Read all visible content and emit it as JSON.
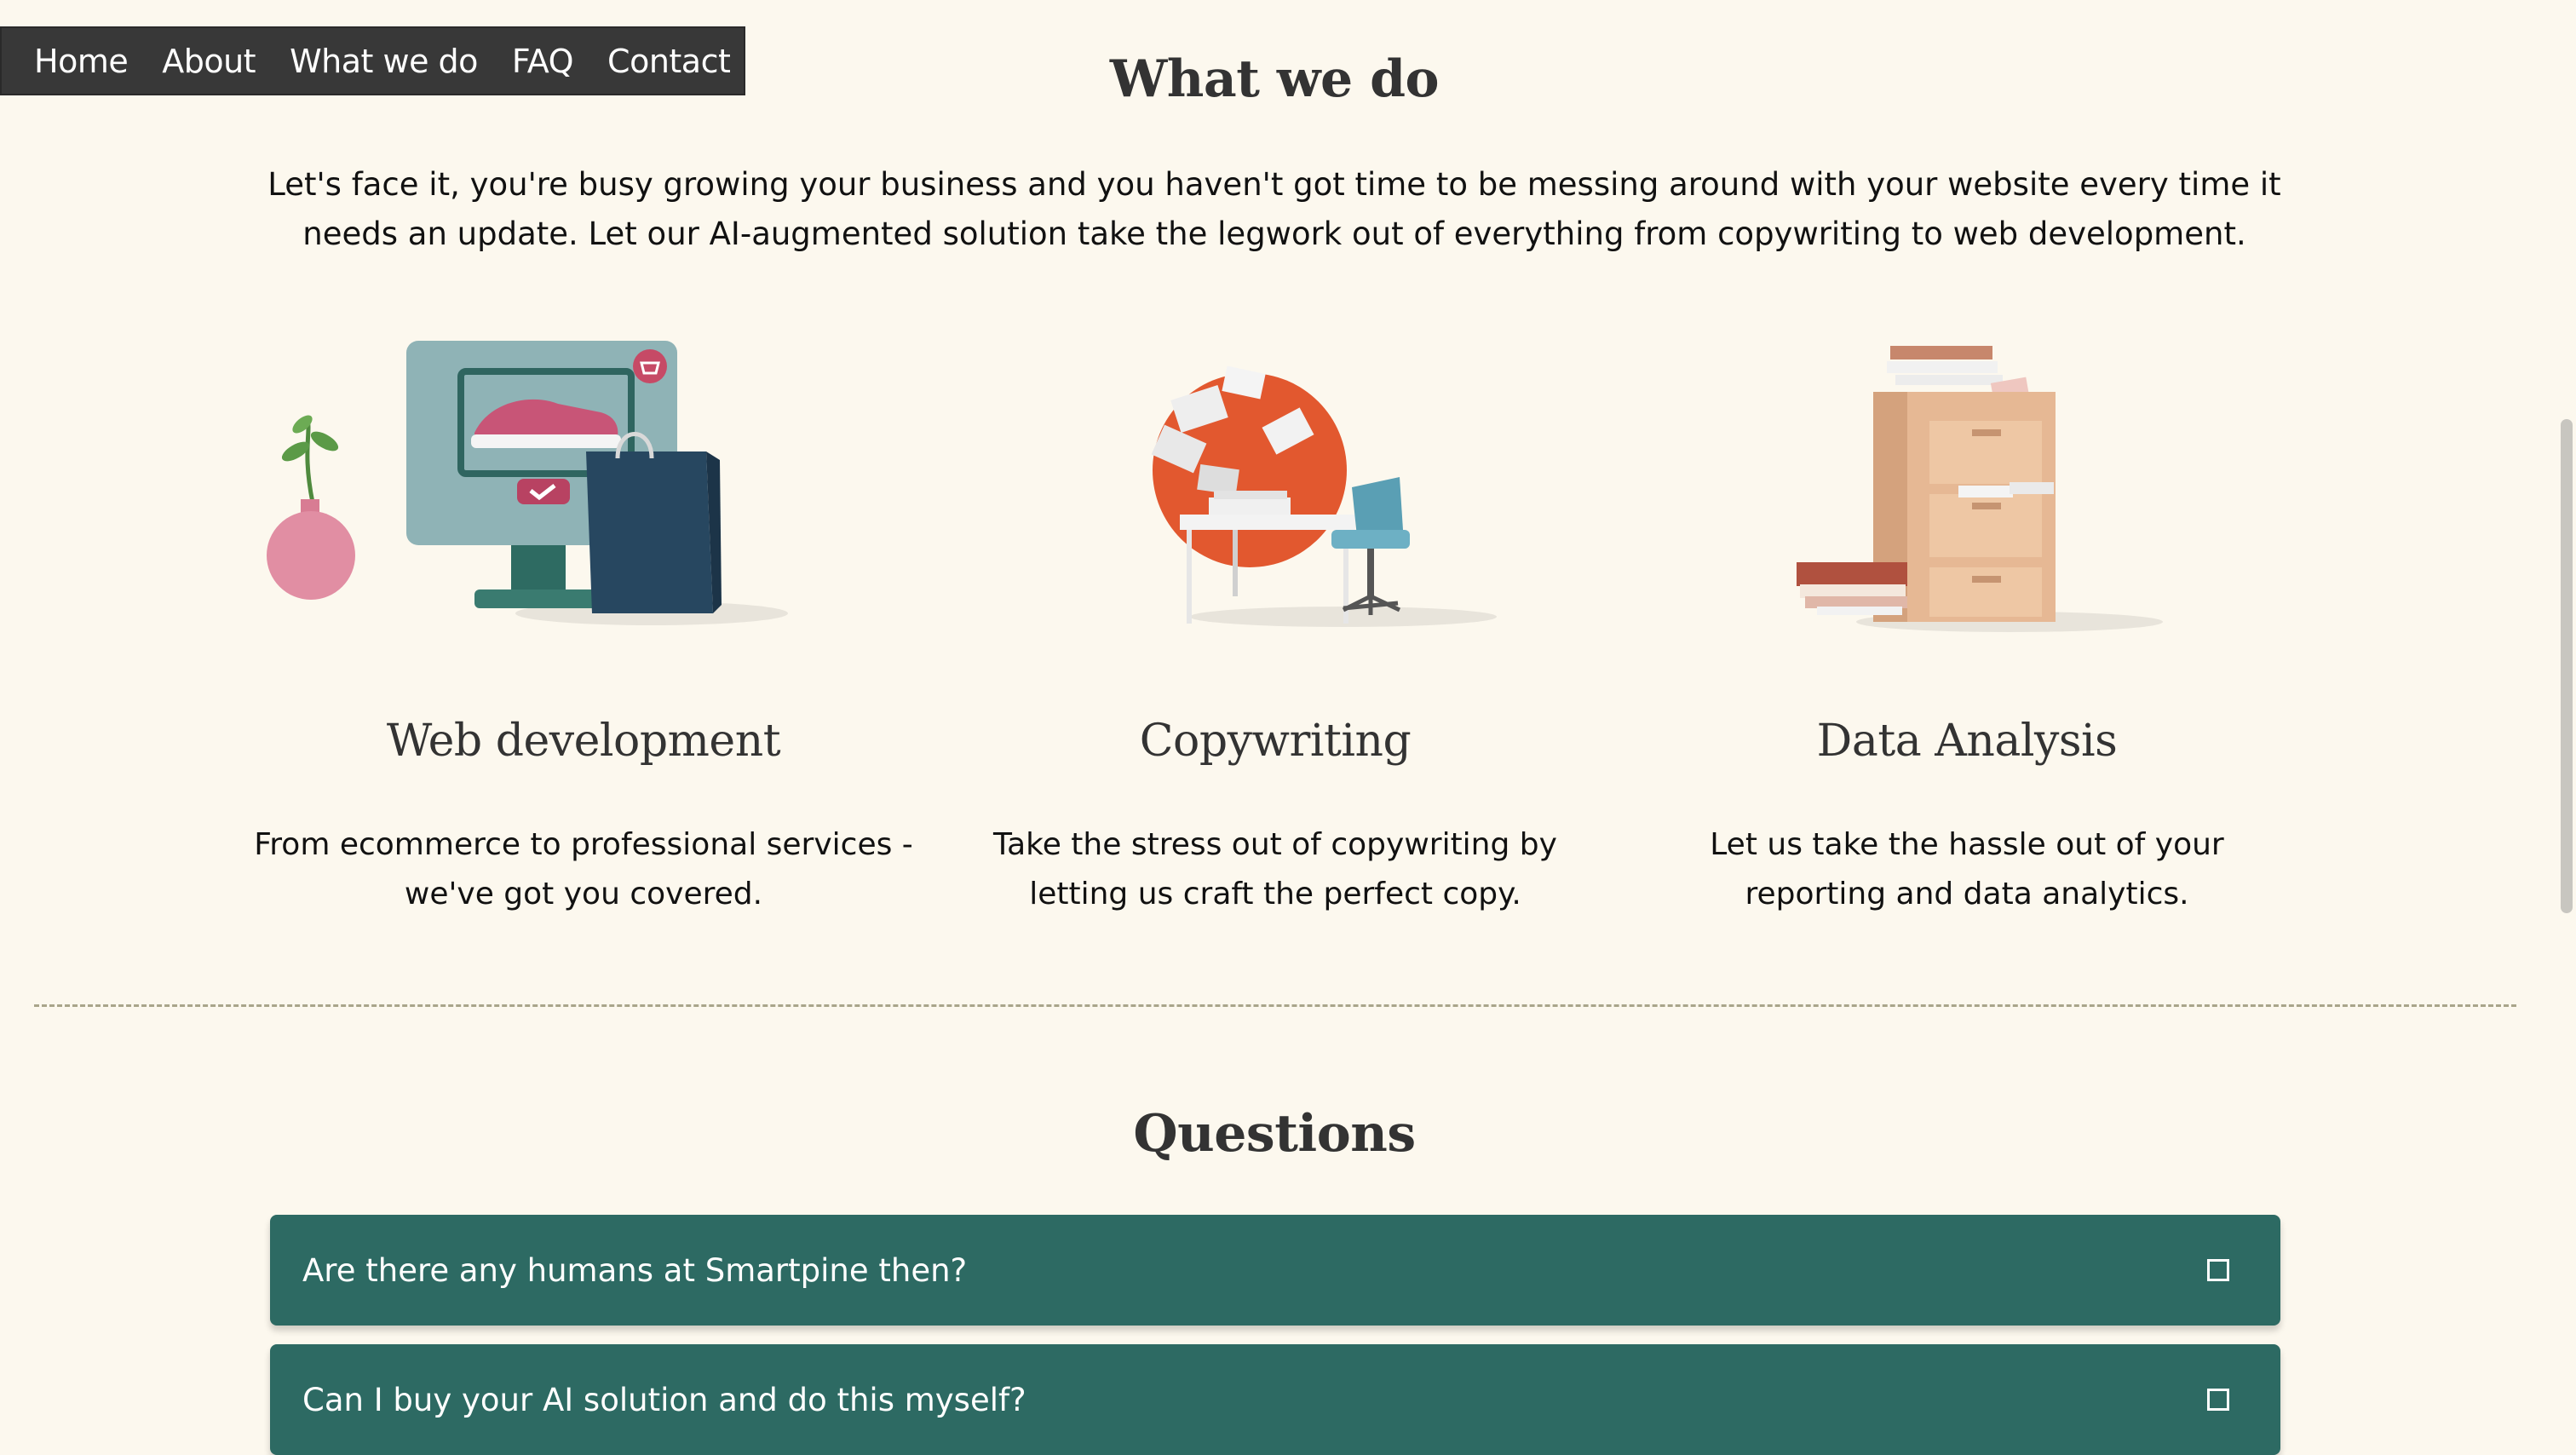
{
  "nav": {
    "items": [
      "Home",
      "About",
      "What we do",
      "FAQ",
      "Contact"
    ]
  },
  "what_we_do": {
    "title": "What we do",
    "intro": "Let's face it, you're busy growing your business and you haven't got time to be messing around with your website every time it needs an update. Let our AI-augmented solution take the legwork out of everything from copywriting to web development.",
    "cards": [
      {
        "title": "Web development",
        "text": "From ecommerce to professional services - we've got you covered.",
        "icon": "ecommerce-illustration"
      },
      {
        "title": "Copywriting",
        "text": "Take the stress out of copywriting by letting us craft the perfect copy.",
        "icon": "desk-papers-illustration"
      },
      {
        "title": "Data Analysis",
        "text": "Let us take the hassle out of your reporting and data analytics.",
        "icon": "filing-cabinet-illustration"
      }
    ]
  },
  "questions": {
    "title": "Questions",
    "items": [
      "Are there any humans at Smartpine then?",
      "Can I buy your AI solution and do this myself?"
    ]
  },
  "colors": {
    "background": "#fcf8ee",
    "nav_bg": "#383838",
    "faq_bg": "#2d6a63",
    "accent_orange": "#e2582f"
  }
}
